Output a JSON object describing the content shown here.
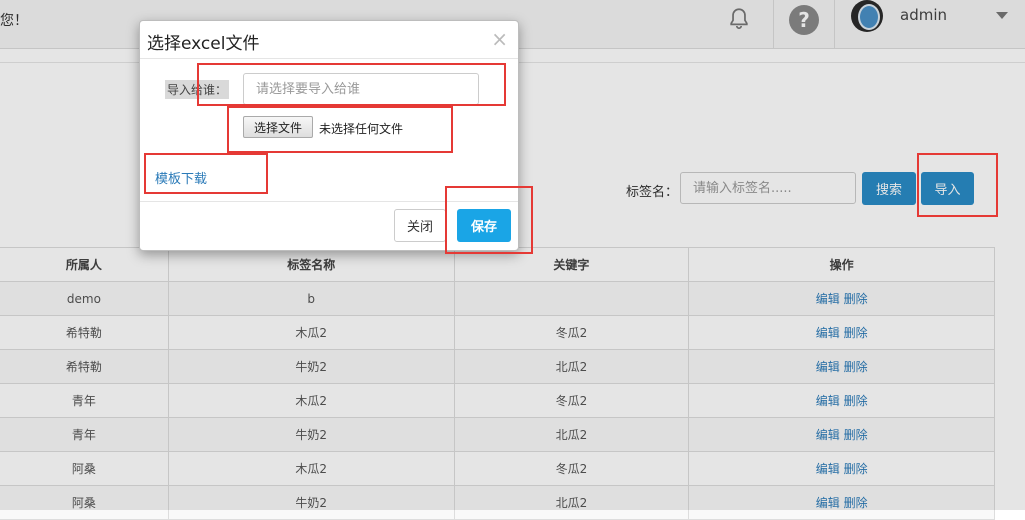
{
  "header": {
    "greeting": "您！",
    "username": "admin"
  },
  "toolbar": {
    "tag_label": "标签名：",
    "tag_placeholder": "请输入标签名.....",
    "search_label": "搜索",
    "import_label": "导入"
  },
  "table": {
    "columns": [
      "所属人",
      "标签名称",
      "关键字",
      "操作"
    ],
    "rows": [
      {
        "owner": "demo",
        "name": "b",
        "keyword": ""
      },
      {
        "owner": "希特勒",
        "name": "木瓜2",
        "keyword": "冬瓜2"
      },
      {
        "owner": "希特勒",
        "name": "牛奶2",
        "keyword": "北瓜2"
      },
      {
        "owner": "青年",
        "name": "木瓜2",
        "keyword": "冬瓜2"
      },
      {
        "owner": "青年",
        "name": "牛奶2",
        "keyword": "北瓜2"
      },
      {
        "owner": "阿桑",
        "name": "木瓜2",
        "keyword": "冬瓜2"
      },
      {
        "owner": "阿桑",
        "name": "牛奶2",
        "keyword": "北瓜2"
      }
    ],
    "edit_label": "编辑",
    "delete_label": "删除"
  },
  "modal": {
    "title": "选择excel文件",
    "close_symbol": "×",
    "import_label": "导入给谁：",
    "import_placeholder": "请选择要导入给谁",
    "file_button": "选择文件",
    "file_status": "未选择任何文件",
    "template_link": "模板下载",
    "close_button": "关闭",
    "save_button": "保存"
  },
  "colors": {
    "primary": "#2a8cc7",
    "save": "#1aa5e6",
    "link": "#2a7ab8",
    "annotation": "#e53935"
  },
  "icons": [
    "bell-icon",
    "help-icon",
    "avatar",
    "chevron-down-icon"
  ]
}
